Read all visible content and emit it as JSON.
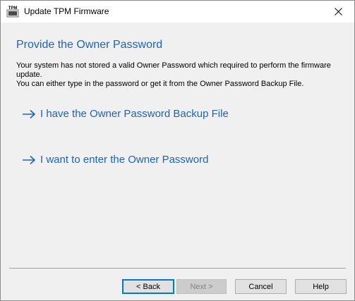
{
  "window": {
    "title": "Update TPM Firmware",
    "icon_name": "tpm-chip-icon",
    "icon_text": "TPM"
  },
  "page": {
    "heading": "Provide the Owner Password",
    "description_line1": "Your system has not stored a valid Owner Password which required to perform the firmware update.",
    "description_line2": "You can either type in the password or get it from the Owner Password Backup File."
  },
  "options": [
    {
      "label": "I have the Owner Password Backup File",
      "icon": "arrow-right-icon"
    },
    {
      "label": "I want to enter the Owner Password",
      "icon": "arrow-right-icon"
    }
  ],
  "buttons": {
    "back": "< Back",
    "next": "Next >",
    "cancel": "Cancel",
    "help": "Help"
  },
  "colors": {
    "accent": "#1f63b5",
    "focus_border": "#0078d7",
    "background": "#f0f0f0",
    "titlebar": "#ffffff"
  }
}
